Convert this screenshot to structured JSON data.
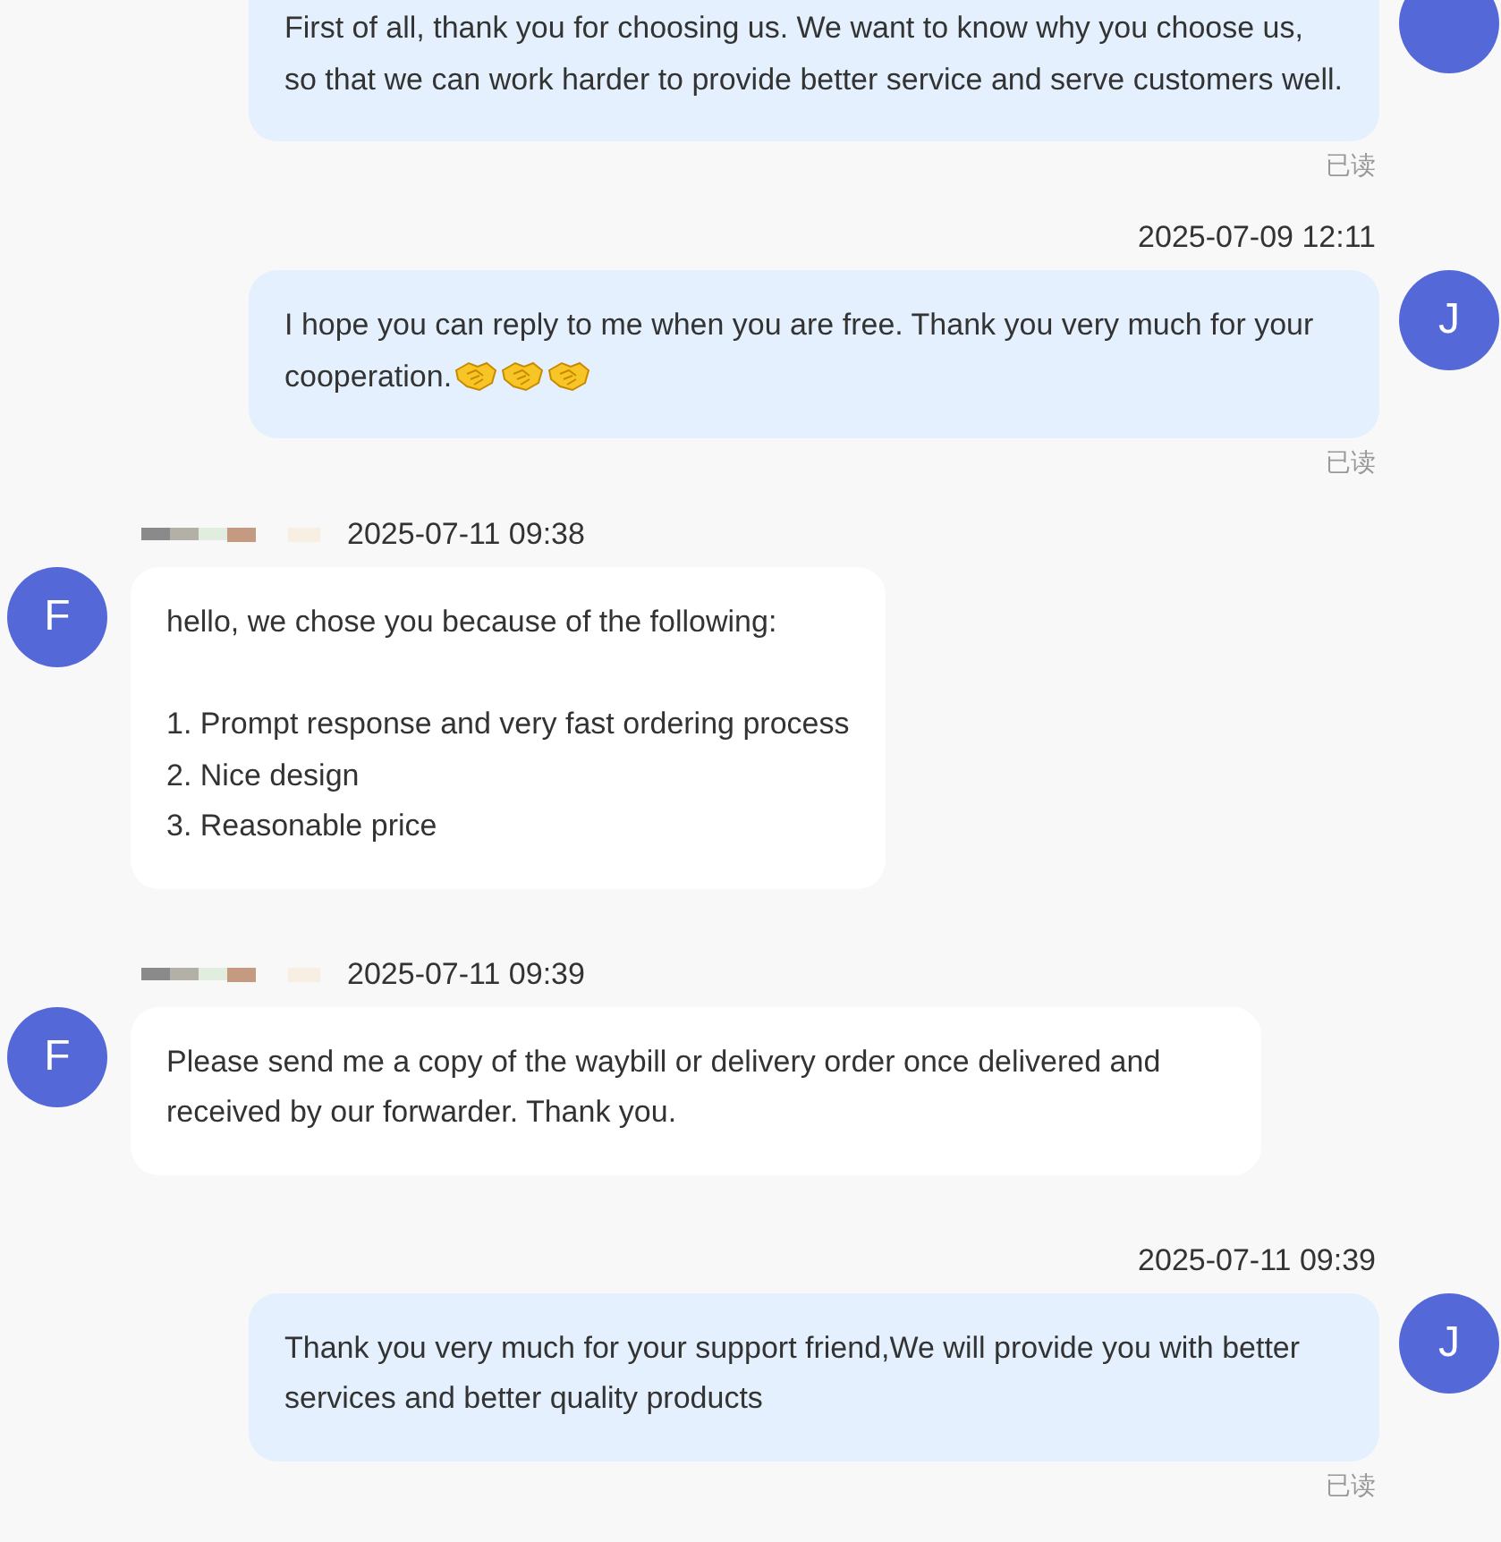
{
  "messages": [
    {
      "kind": "outgoing",
      "text": "First of all, thank you for choosing us. We want to know why you choose us, so that we can work harder to provide better service and serve customers well.",
      "read_status": "已读"
    },
    {
      "kind": "outgoing",
      "timestamp": "2025-07-09 12:11",
      "avatar_letter": "J",
      "text": "I hope you can reply to me when you are free. Thank you very much for your cooperation.",
      "trailing_icons": [
        {
          "kind": "handshake"
        },
        {
          "kind": "handshake"
        },
        {
          "kind": "handshake"
        }
      ],
      "read_status": "已读"
    },
    {
      "kind": "incoming",
      "sender_name_redacted": true,
      "timestamp": "2025-07-11 09:38",
      "avatar_letter": "F",
      "text": "hello, we chose you because of the following:\n\n1. Prompt response and very fast ordering process\n2. Nice design\n3. Reasonable price"
    },
    {
      "kind": "incoming",
      "sender_name_redacted": true,
      "timestamp": "2025-07-11 09:39",
      "avatar_letter": "F",
      "text": "Please send me a copy of the waybill or delivery order once delivered and received by our forwarder. Thank you."
    },
    {
      "kind": "outgoing",
      "timestamp": "2025-07-11 09:39",
      "avatar_letter": "J",
      "text": "Thank you very much for your support friend,We will provide you with better services and better quality products",
      "read_status": "已读"
    }
  ]
}
